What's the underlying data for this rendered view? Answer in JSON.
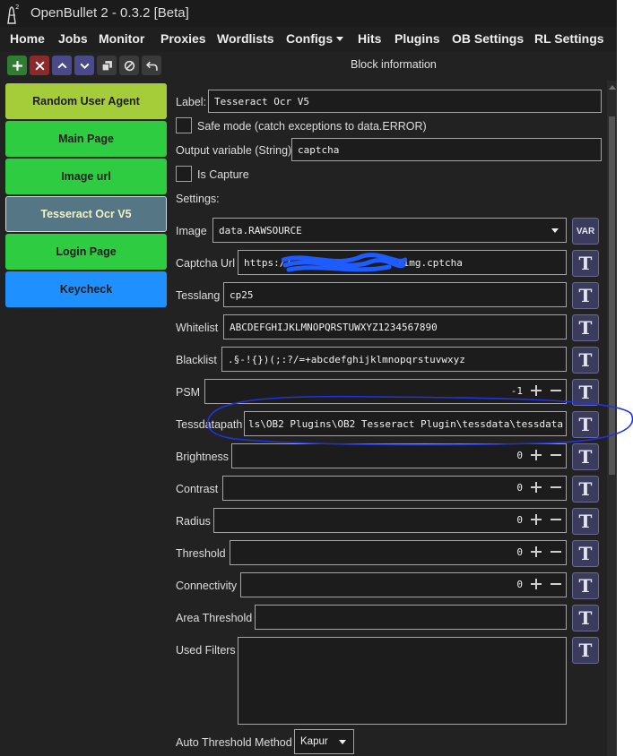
{
  "window": {
    "title": "OpenBullet 2 - 0.3.2 [Beta]"
  },
  "menu": {
    "items": [
      {
        "label": "Home"
      },
      {
        "label": "Jobs"
      },
      {
        "label": "Monitor"
      },
      {
        "label": "Proxies"
      },
      {
        "label": "Wordlists"
      },
      {
        "label": "Configs"
      },
      {
        "label": "Hits"
      },
      {
        "label": "Plugins"
      },
      {
        "label": "OB Settings"
      },
      {
        "label": "RL Settings"
      }
    ]
  },
  "toolbar": {
    "buttons": [
      "add-icon",
      "delete-icon",
      "move-up-icon",
      "move-down-icon",
      "clone-icon",
      "disable-icon",
      "undo-icon"
    ],
    "colors": {
      "add": "#2e7d32",
      "delete": "#8b2a2a",
      "move": "#4a4a8a"
    }
  },
  "blocks": [
    {
      "label": "Random User Agent",
      "color": "#a5cd39"
    },
    {
      "label": "Main Page",
      "color": "#2ecc40"
    },
    {
      "label": "Image url",
      "color": "#2ecc40"
    },
    {
      "label": "Tesseract Ocr V5",
      "color": "#557684",
      "selected": true
    },
    {
      "label": "Login Page",
      "color": "#2ecc40"
    },
    {
      "label": "Keycheck",
      "color": "#1e90ff"
    }
  ],
  "block_info": {
    "title": "Block information",
    "label_caption": "Label:",
    "label_value": "Tesseract Ocr V5",
    "safe_mode": "Safe mode (catch exceptions to data.ERROR)",
    "output_caption": "Output variable (String)",
    "output_value": "captcha",
    "is_capture": "Is Capture",
    "settings_caption": "Settings:"
  },
  "settings": {
    "image": {
      "label": "Image",
      "value": "data.RAWSOURCE",
      "var_button": "VAR"
    },
    "captcha_url": {
      "label": "Captcha Url",
      "value_start": "https://",
      "value_end": "/img.cptcha"
    },
    "tesslang": {
      "label": "Tesslang",
      "value": "cp25"
    },
    "whitelist": {
      "label": "Whitelist",
      "value": "ABCDEFGHIJKLMNOPQRSTUWXYZ1234567890"
    },
    "blacklist": {
      "label": "Blacklist",
      "value": ".§-!{})(;:?/=+abcdefghijklmnopqrstuvwxyz"
    },
    "psm": {
      "label": "PSM",
      "value": "-1"
    },
    "tessdatapath": {
      "label": "Tessdatapath",
      "value": "ls\\OB2 Plugins\\OB2 Tesseract Plugin\\tessdata\\tessdata"
    },
    "brightness": {
      "label": "Brightness",
      "value": "0"
    },
    "contrast": {
      "label": "Contrast",
      "value": "0"
    },
    "radius": {
      "label": "Radius",
      "value": "0"
    },
    "threshold": {
      "label": "Threshold",
      "value": "0"
    },
    "connectivity": {
      "label": "Connectivity",
      "value": "0"
    },
    "area_threshold": {
      "label": "Area Threshold",
      "value": ""
    },
    "used_filters": {
      "label": "Used Filters",
      "value": ""
    },
    "auto_threshold_method": {
      "label": "Auto Threshold Method",
      "value": "Kapur"
    }
  },
  "t_button_label": "T",
  "annotation_color": "#2233dd",
  "redaction_color": "#1e5cff"
}
